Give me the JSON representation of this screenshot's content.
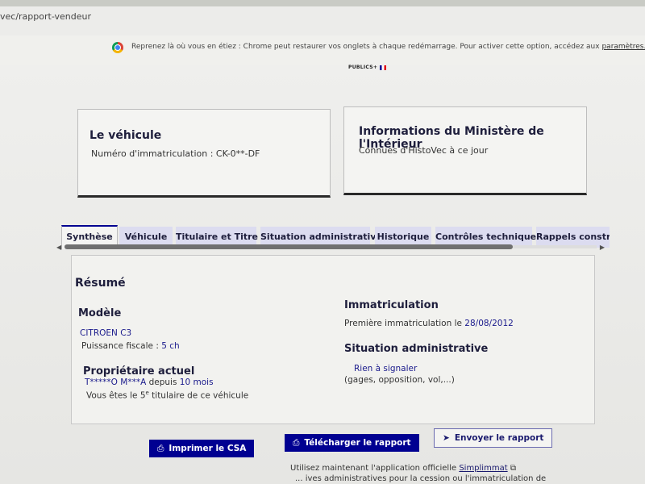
{
  "browser": {
    "url": "vec/rapport-vendeur",
    "infobar_message": "Reprenez là où vous en étiez : Chrome peut restaurer vos onglets à chaque redémarrage. Pour activer cette option, accédez aux",
    "infobar_link": "paramètres."
  },
  "logo": {
    "text": "PUBLICS+"
  },
  "vehicle_card": {
    "title": "Le véhicule",
    "plate_line": "Numéro d'immatriculation : CK-0**-DF"
  },
  "ministry_card": {
    "title": "Informations du Ministère de l'Intérieur",
    "subtitle": "Connues d'HistoVec à ce jour"
  },
  "tabs": [
    "Synthèse",
    "Véhicule",
    "Titulaire et Titre",
    "Situation administrative",
    "Historique",
    "Contrôles techniques",
    "Rappels constru"
  ],
  "summary": {
    "heading": "Résumé",
    "model_heading": "Modèle",
    "model_value": "CITROEN C3",
    "fiscal_label": "Puissance fiscale :",
    "fiscal_value": "5 ch",
    "owner_heading": "Propriétaire actuel",
    "owner_name": "T*****O M***A",
    "owner_since_label": "depuis",
    "owner_since_value": "10 mois",
    "owner_rank_prefix": "Vous êtes le 5",
    "owner_rank_sup": "e",
    "owner_rank_suffix": "titulaire de ce véhicule",
    "registration_heading": "Immatriculation",
    "first_registration_label": "Première immatriculation le",
    "first_registration_value": "28/08/2012",
    "admin_heading": "Situation administrative",
    "admin_value": "Rien à signaler",
    "admin_note": "(gages, opposition, vol,...)"
  },
  "actions": {
    "print": "Imprimer le CSA",
    "download": "Télécharger le rapport",
    "send": "Envoyer le rapport"
  },
  "footer": {
    "line1_prefix": "Utilisez maintenant l'application officielle",
    "line1_link": "Simplimmat",
    "line2": "... ives administratives pour la cession ou l'immatriculation de"
  }
}
